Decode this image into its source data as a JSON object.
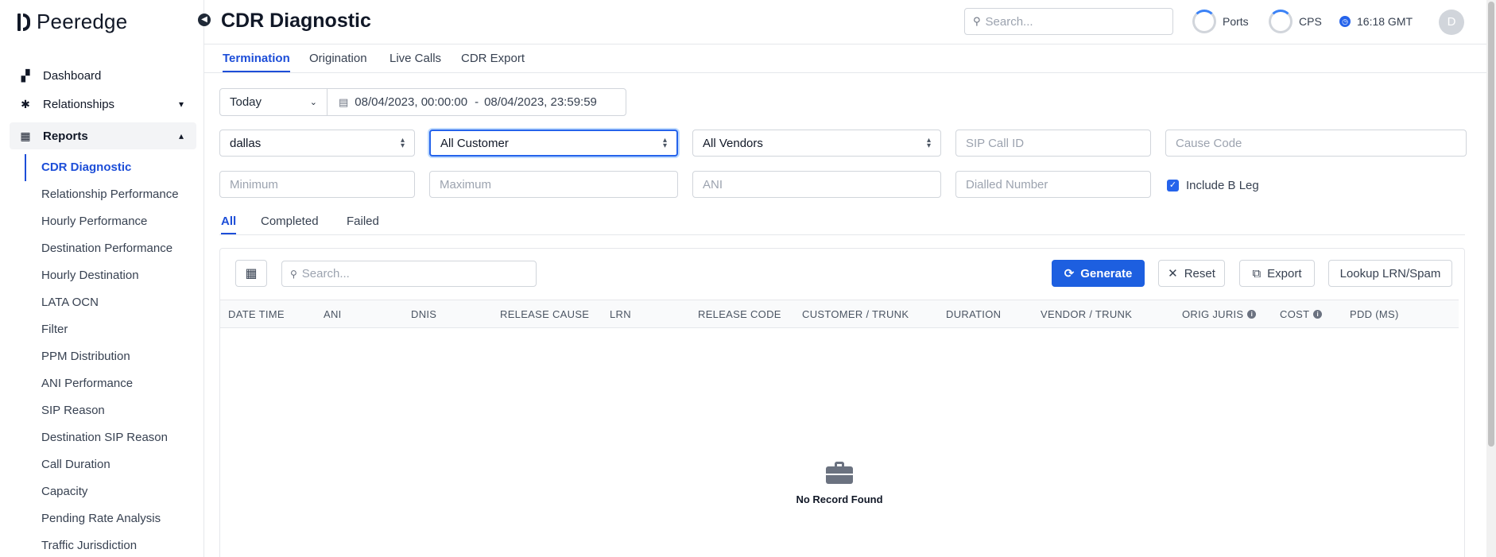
{
  "app": {
    "name": "Peeredge"
  },
  "sidebar": {
    "items": [
      {
        "label": "Dashboard",
        "icon": "dashboard-icon"
      },
      {
        "label": "Relationships",
        "icon": "relationships-icon"
      },
      {
        "label": "Reports",
        "icon": "reports-icon"
      }
    ],
    "reports_sub": [
      "CDR Diagnostic",
      "Relationship Performance",
      "Hourly Performance",
      "Destination Performance",
      "Hourly Destination",
      "LATA OCN",
      "Filter",
      "PPM Distribution",
      "ANI Performance",
      "SIP Reason",
      "Destination SIP Reason",
      "Call Duration",
      "Capacity",
      "Pending Rate Analysis",
      "Traffic Jurisdiction"
    ],
    "active_sub": "CDR Diagnostic"
  },
  "header": {
    "title": "CDR Diagnostic",
    "search_placeholder": "Search...",
    "ports_label": "Ports",
    "cps_label": "CPS",
    "time": "16:18 GMT",
    "avatar_initial": "D"
  },
  "tabs": [
    "Termination",
    "Origination",
    "Live Calls",
    "CDR Export"
  ],
  "active_tab": "Termination",
  "filters": {
    "period": "Today",
    "date_start": "08/04/2023, 00:00:00",
    "date_separator": "-",
    "date_end": "08/04/2023, 23:59:59",
    "switch": "dallas",
    "customer": "All Customer",
    "vendor": "All Vendors",
    "sip_call_id_placeholder": "SIP Call ID",
    "cause_code_placeholder": "Cause Code",
    "minimum_placeholder": "Minimum",
    "maximum_placeholder": "Maximum",
    "ani_placeholder": "ANI",
    "dialled_number_placeholder": "Dialled Number",
    "include_b_leg_label": "Include B Leg",
    "include_b_leg_checked": true
  },
  "status_tabs": [
    "All",
    "Completed",
    "Failed"
  ],
  "active_status_tab": "All",
  "table": {
    "search_placeholder": "Search...",
    "buttons": {
      "generate": "Generate",
      "reset": "Reset",
      "export": "Export",
      "lookup": "Lookup LRN/Spam"
    },
    "columns": [
      "DATE TIME",
      "ANI",
      "DNIS",
      "RELEASE CAUSE",
      "LRN",
      "RELEASE CODE",
      "CUSTOMER / TRUNK",
      "DURATION",
      "VENDOR / TRUNK",
      "ORIG JURIS",
      "COST",
      "PDD (MS)"
    ],
    "empty_message": "No Record Found"
  },
  "colors": {
    "accent": "#1d4ed8",
    "primary_button": "#1d5fe0"
  }
}
